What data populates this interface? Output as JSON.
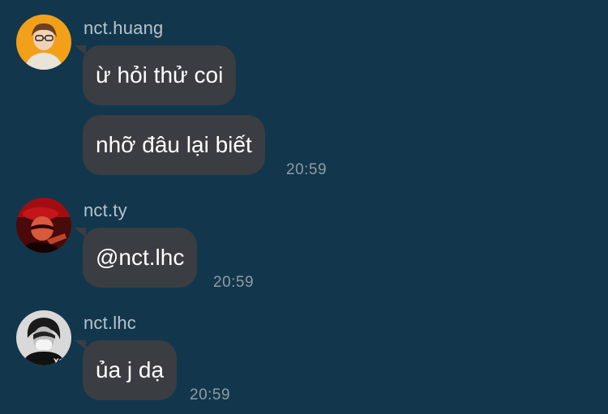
{
  "messages": [
    {
      "user": "nct.huang",
      "avatar": "avatar-yellow-background",
      "bubbles": [
        "ừ hỏi thử coi",
        "nhỡ đâu lại biết"
      ],
      "time": "20:59"
    },
    {
      "user": "nct.ty",
      "avatar": "avatar-red-tinted",
      "bubbles": [
        "@nct.lhc"
      ],
      "time": "20:59"
    },
    {
      "user": "nct.lhc",
      "avatar": "avatar-black-white-mask",
      "bubbles": [
        "ủa j dạ"
      ],
      "time": "20:59"
    }
  ],
  "colors": {
    "background": "#12374d",
    "bubble": "#3a3d42",
    "username": "#b7c3cb",
    "timestamp": "#8e9ba4",
    "message_text": "#ffffff"
  }
}
